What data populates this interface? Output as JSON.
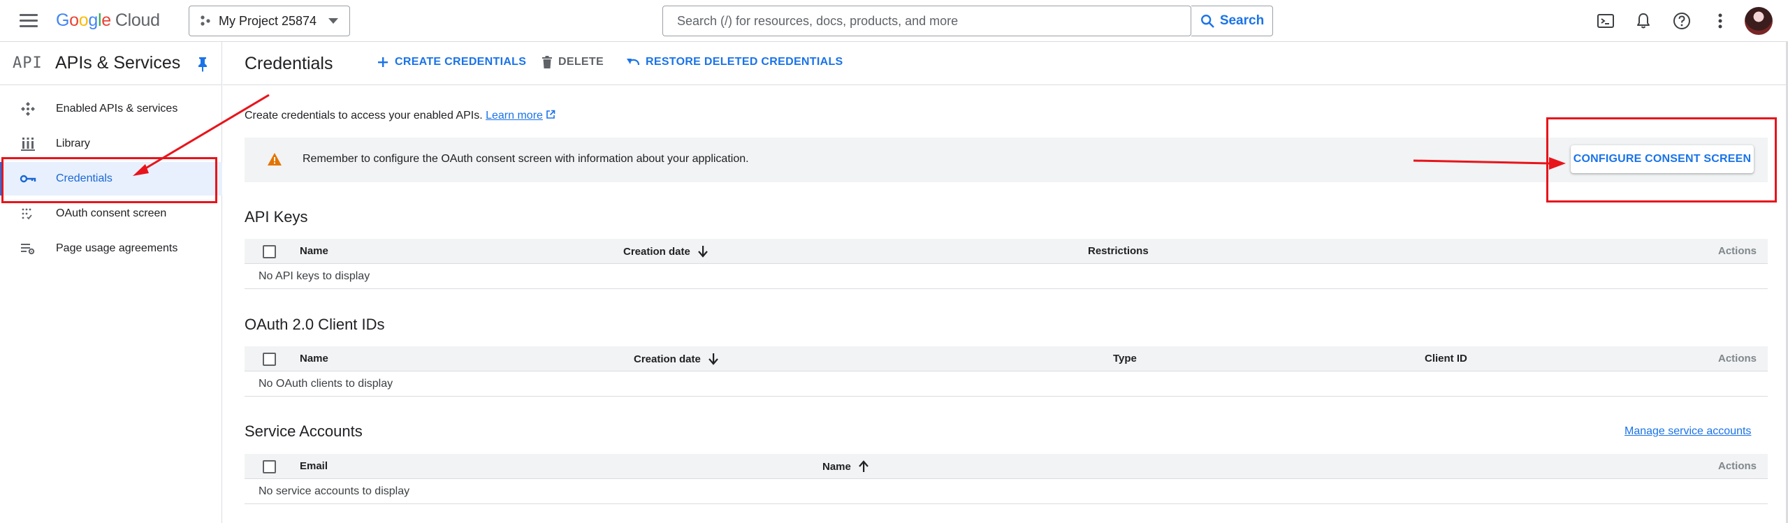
{
  "topbar": {
    "logo": {
      "g1": "G",
      "g2": "o",
      "g3": "o",
      "g4": "g",
      "g5": "l",
      "g6": "e",
      "product": "Cloud"
    },
    "project": "My Project 25874",
    "search_placeholder": "Search (/) for resources, docs, products, and more",
    "search_button": "Search",
    "icons": [
      "menu-icon",
      "project-icon",
      "search-icon",
      "cloud-shell-icon",
      "notifications-icon",
      "help-icon",
      "more-vert-icon",
      "avatar"
    ]
  },
  "sidebar": {
    "badge": "API",
    "title": "APIs & Services",
    "items": [
      {
        "label": "Enabled APIs & services",
        "icon": "enabled-apis-icon"
      },
      {
        "label": "Library",
        "icon": "library-icon"
      },
      {
        "label": "Credentials",
        "icon": "key-icon",
        "active": true
      },
      {
        "label": "OAuth consent screen",
        "icon": "consent-screen-icon"
      },
      {
        "label": "Page usage agreements",
        "icon": "settings-list-icon"
      }
    ]
  },
  "header": {
    "title": "Credentials",
    "create": "CREATE CREDENTIALS",
    "delete": "DELETE",
    "restore": "RESTORE DELETED CREDENTIALS"
  },
  "intro": {
    "text": "Create credentials to access your enabled APIs.",
    "link": "Learn more"
  },
  "banner": {
    "text": "Remember to configure the OAuth consent screen with information about your application.",
    "button": "CONFIGURE CONSENT SCREEN"
  },
  "api_keys": {
    "title": "API Keys",
    "columns": [
      "Name",
      "Creation date",
      "Restrictions",
      "Actions"
    ],
    "empty": "No API keys to display"
  },
  "oauth_clients": {
    "title": "OAuth 2.0 Client IDs",
    "columns": [
      "Name",
      "Creation date",
      "Type",
      "Client ID",
      "Actions"
    ],
    "empty": "No OAuth clients to display"
  },
  "service_accounts": {
    "title": "Service Accounts",
    "manage_link": "Manage service accounts",
    "columns": [
      "Email",
      "Name",
      "Actions"
    ],
    "empty": "No service accounts to display"
  },
  "colors": {
    "accent": "#1a73e8",
    "annotation_red": "#e8141b",
    "warning": "#e37400",
    "banner_bg": "#f1f3f4",
    "active_bg": "#e8f0fe"
  }
}
